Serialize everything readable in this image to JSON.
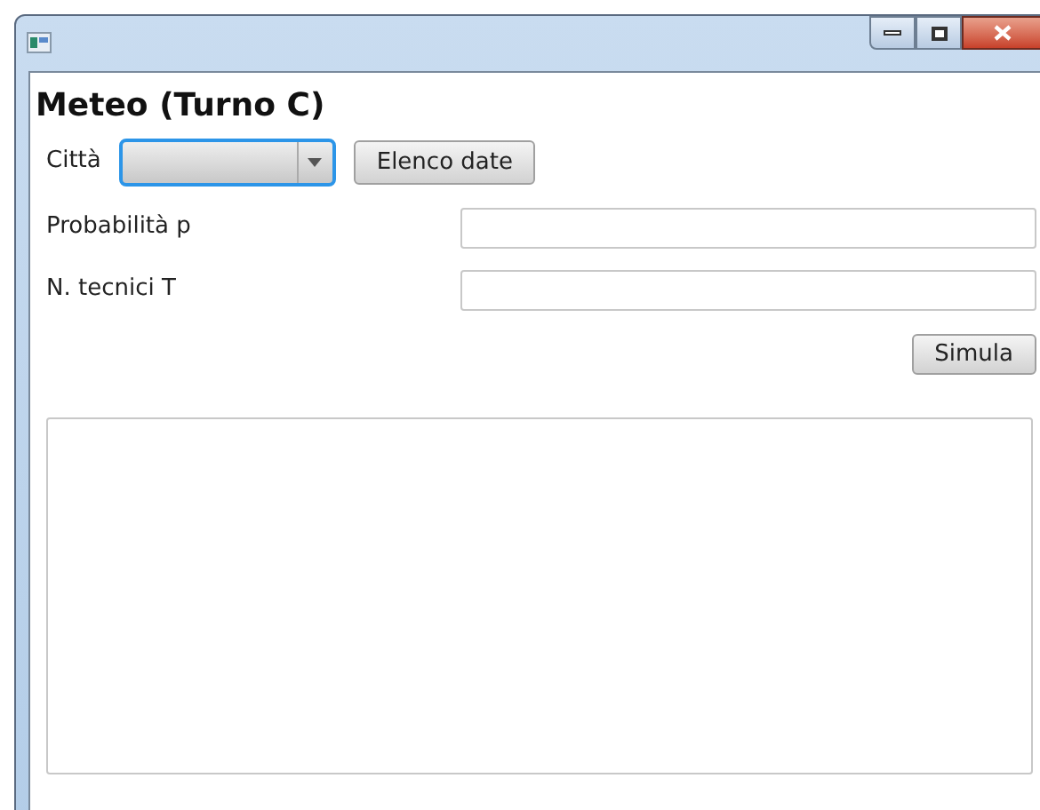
{
  "heading": "Meteo (Turno C)",
  "city": {
    "label": "Città",
    "focused": true
  },
  "list_button": "Elenco date",
  "fields": [
    {
      "label": "Probabilità p"
    },
    {
      "label": "N. tecnici T"
    }
  ],
  "simulate_button": "Simula"
}
